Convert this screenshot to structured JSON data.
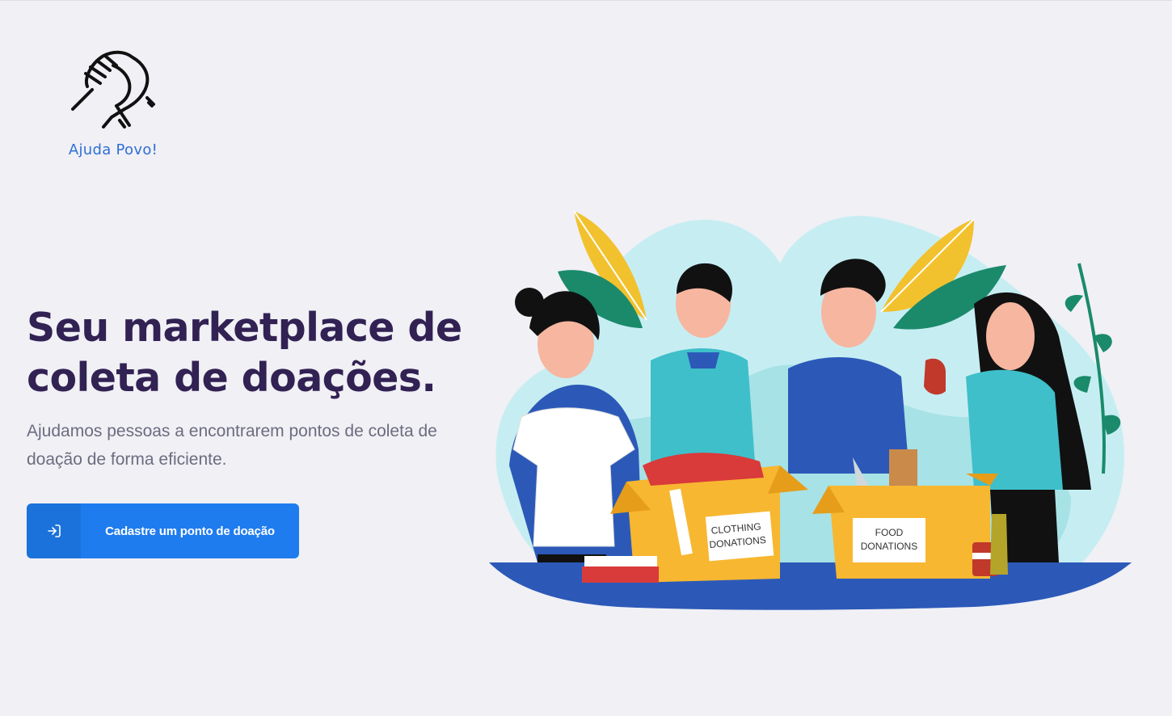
{
  "logo": {
    "text": "Ajuda Povo!",
    "icon": "handshake-icon"
  },
  "hero": {
    "title": "Seu marketplace de coleta de doações.",
    "subtitle": "Ajudamos pessoas a encontrarem pontos de coleta de doação de forma eficiente."
  },
  "cta": {
    "label": "Cadastre um ponto de doação",
    "icon": "sign-in-icon"
  },
  "illustration": {
    "clothing_box": [
      "CLOTHING",
      "DONATIONS"
    ],
    "food_box": [
      "FOOD",
      "DONATIONS"
    ]
  },
  "colors": {
    "background": "#f0f0f5",
    "title": "#322153",
    "text": "#6c6c80",
    "accent": "#1f7cee",
    "logo_text": "#2f6fd6"
  }
}
